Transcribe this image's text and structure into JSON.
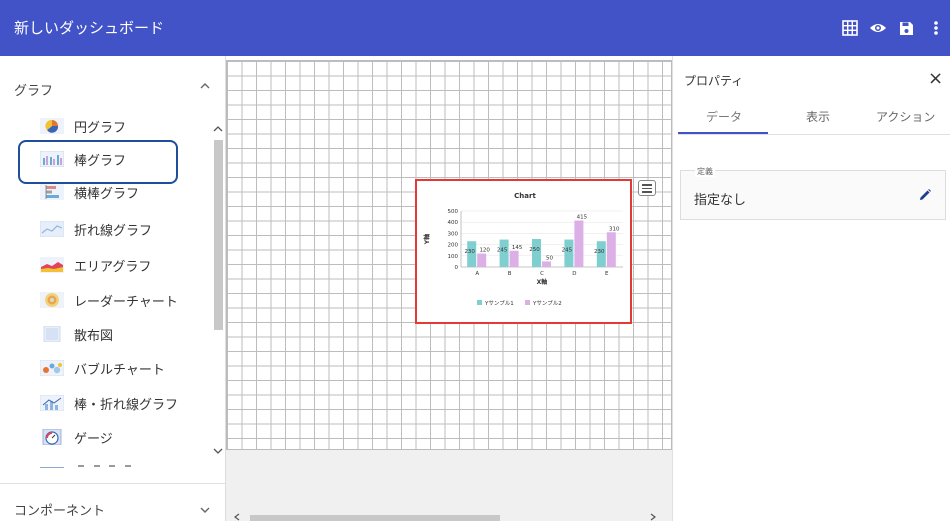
{
  "header": {
    "title": "新しいダッシュボード",
    "icons": [
      "grid-icon",
      "eye-icon",
      "save-icon",
      "more-vert-icon"
    ]
  },
  "left_panel": {
    "graph_section": {
      "label": "グラフ",
      "expanded": true
    },
    "items": [
      {
        "label": "円グラフ",
        "icon": "pie-chart-icon"
      },
      {
        "label": "棒グラフ",
        "icon": "bar-chart-icon"
      },
      {
        "label": "横棒グラフ",
        "icon": "horizontal-bar-chart-icon"
      },
      {
        "label": "折れ線グラフ",
        "icon": "line-chart-icon"
      },
      {
        "label": "エリアグラフ",
        "icon": "area-chart-icon"
      },
      {
        "label": "レーダーチャート",
        "icon": "radar-chart-icon"
      },
      {
        "label": "散布図",
        "icon": "scatter-chart-icon"
      },
      {
        "label": "バブルチャート",
        "icon": "bubble-chart-icon"
      },
      {
        "label": "棒・折れ線グラフ",
        "icon": "bar-line-chart-icon"
      },
      {
        "label": "ゲージ",
        "icon": "gauge-icon"
      }
    ],
    "component_section": {
      "label": "コンポーネント",
      "expanded": false
    }
  },
  "widget": {
    "chart_data": {
      "type": "bar",
      "title": "Chart",
      "xlabel": "X軸",
      "ylabel": "Y軸",
      "ylim": [
        0,
        500
      ],
      "yticks": [
        0,
        100,
        200,
        300,
        400,
        500
      ],
      "categories": [
        "A",
        "B",
        "C",
        "D",
        "E"
      ],
      "series": [
        {
          "name": "Yサンプル1",
          "values": [
            230,
            245,
            250,
            245,
            230
          ],
          "color": "#80cfd0"
        },
        {
          "name": "Yサンプル2",
          "values": [
            120,
            145,
            50,
            415,
            310
          ],
          "color": "#dcb0e6"
        }
      ],
      "legend": "bottom"
    }
  },
  "properties": {
    "title": "プロパティ",
    "close_label": "×",
    "tabs": [
      {
        "label": "データ",
        "active": true
      },
      {
        "label": "表示",
        "active": false
      },
      {
        "label": "アクション",
        "active": false
      }
    ],
    "field_label": "定義",
    "field_value": "指定なし"
  },
  "colors": {
    "header_bg": "#4253c8",
    "highlight_border": "#1f4e9a",
    "widget_border": "#e53935",
    "accent": "#4253c8"
  }
}
